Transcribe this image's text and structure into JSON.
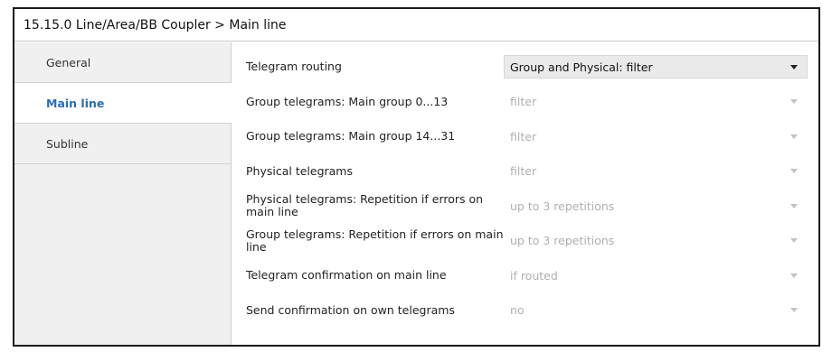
{
  "window": {
    "title": "15.15.0 Line/Area/BB Coupler > Main line"
  },
  "sidebar": {
    "items": [
      {
        "label": "General",
        "active": false
      },
      {
        "label": "Main line",
        "active": true
      },
      {
        "label": "Subline",
        "active": false
      }
    ]
  },
  "params": [
    {
      "label": "Telegram routing",
      "value": "Group and Physical: filter",
      "enabled": true
    },
    {
      "label": "Group telegrams: Main group 0...13",
      "value": "filter",
      "enabled": false
    },
    {
      "label": "Group telegrams: Main group 14...31",
      "value": "filter",
      "enabled": false
    },
    {
      "label": "Physical telegrams",
      "value": "filter",
      "enabled": false
    },
    {
      "label": "Physical telegrams: Repetition if errors on main line",
      "value": "up to 3 repetitions",
      "enabled": false
    },
    {
      "label": "Group telegrams: Repetition if errors on main line",
      "value": "up to 3 repetitions",
      "enabled": false
    },
    {
      "label": "Telegram confirmation on main line",
      "value": "if routed",
      "enabled": false
    },
    {
      "label": "Send confirmation on own telegrams",
      "value": "no",
      "enabled": false
    }
  ]
}
